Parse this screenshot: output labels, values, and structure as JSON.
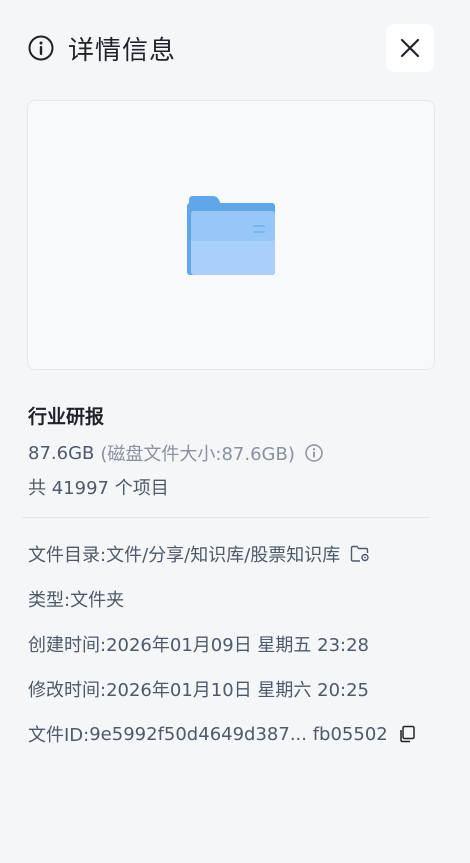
{
  "header": {
    "title": "详情信息"
  },
  "file": {
    "name": "行业研报",
    "size": "87.6GB",
    "disk_size": "(磁盘文件大小:87.6GB)",
    "item_count": "共 41997 个项目"
  },
  "details": {
    "directory_label": "文件目录:",
    "directory_value": "文件/分享/知识库/股票知识库",
    "type_label": "类型:",
    "type_value": "文件夹",
    "created_label": "创建时间:",
    "created_value": "2026年01月09日 星期五 23:28",
    "modified_label": "修改时间:",
    "modified_value": "2026年01月10日 星期六 20:25",
    "id_label": "文件ID:",
    "id_value": "9e5992f50d4649d387... fb05502"
  },
  "icons": {
    "info": "info-circle-icon",
    "close": "close-icon",
    "folder": "folder-icon",
    "locate": "folder-locate-icon",
    "copy": "copy-icon"
  },
  "colors": {
    "background": "#f5f6f8",
    "folder_blue": "#6aaef0",
    "folder_light": "#a8d0fa",
    "text_primary": "#1f2329",
    "text_secondary": "#4e5969",
    "text_muted": "#8a919f"
  }
}
